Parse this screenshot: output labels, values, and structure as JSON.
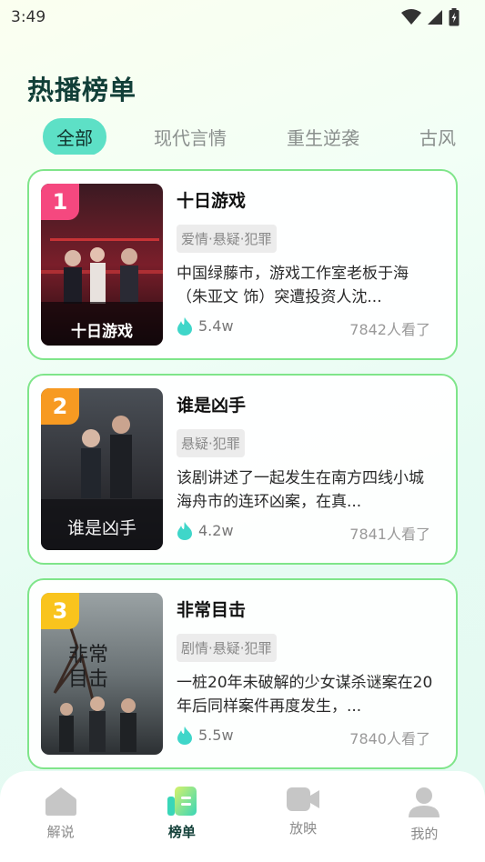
{
  "status": {
    "time": "3:49"
  },
  "page": {
    "title": "热播榜单"
  },
  "tabs": [
    {
      "label": "全部",
      "active": true
    },
    {
      "label": "现代言情"
    },
    {
      "label": "重生逆袭"
    },
    {
      "label": "古风"
    }
  ],
  "items": [
    {
      "rank": "1",
      "title": "十日游戏",
      "tag": "爱情·悬疑·犯罪",
      "desc": "中国绿藤市，游戏工作室老板于海（朱亚文 饰）突遭投资人沈...",
      "hot": "5.4w",
      "views": "7842人看了",
      "rank_color": "#f5487f"
    },
    {
      "rank": "2",
      "title": "谁是凶手",
      "tag": "悬疑·犯罪",
      "desc": "该剧讲述了一起发生在南方四线小城海舟市的连环凶案，在真...",
      "hot": "4.2w",
      "views": "7841人看了",
      "rank_color": "#f79a22"
    },
    {
      "rank": "3",
      "title": "非常目击",
      "tag": "剧情·悬疑·犯罪",
      "desc": "一桩20年未破解的少女谋杀谜案在20年后同样案件再度发生，...",
      "hot": "5.5w",
      "views": "7840人看了",
      "rank_color": "#f9c41d"
    }
  ],
  "nav": [
    {
      "label": "解说",
      "icon": "home-icon"
    },
    {
      "label": "榜单",
      "icon": "ranking-icon",
      "active": true
    },
    {
      "label": "放映",
      "icon": "video-camera-icon"
    },
    {
      "label": "我的",
      "icon": "user-icon"
    }
  ],
  "colors": {
    "accent": "#5de0c6",
    "card_border": "#7fe58a",
    "title": "#123f38",
    "flame": "#3fd6c9"
  }
}
